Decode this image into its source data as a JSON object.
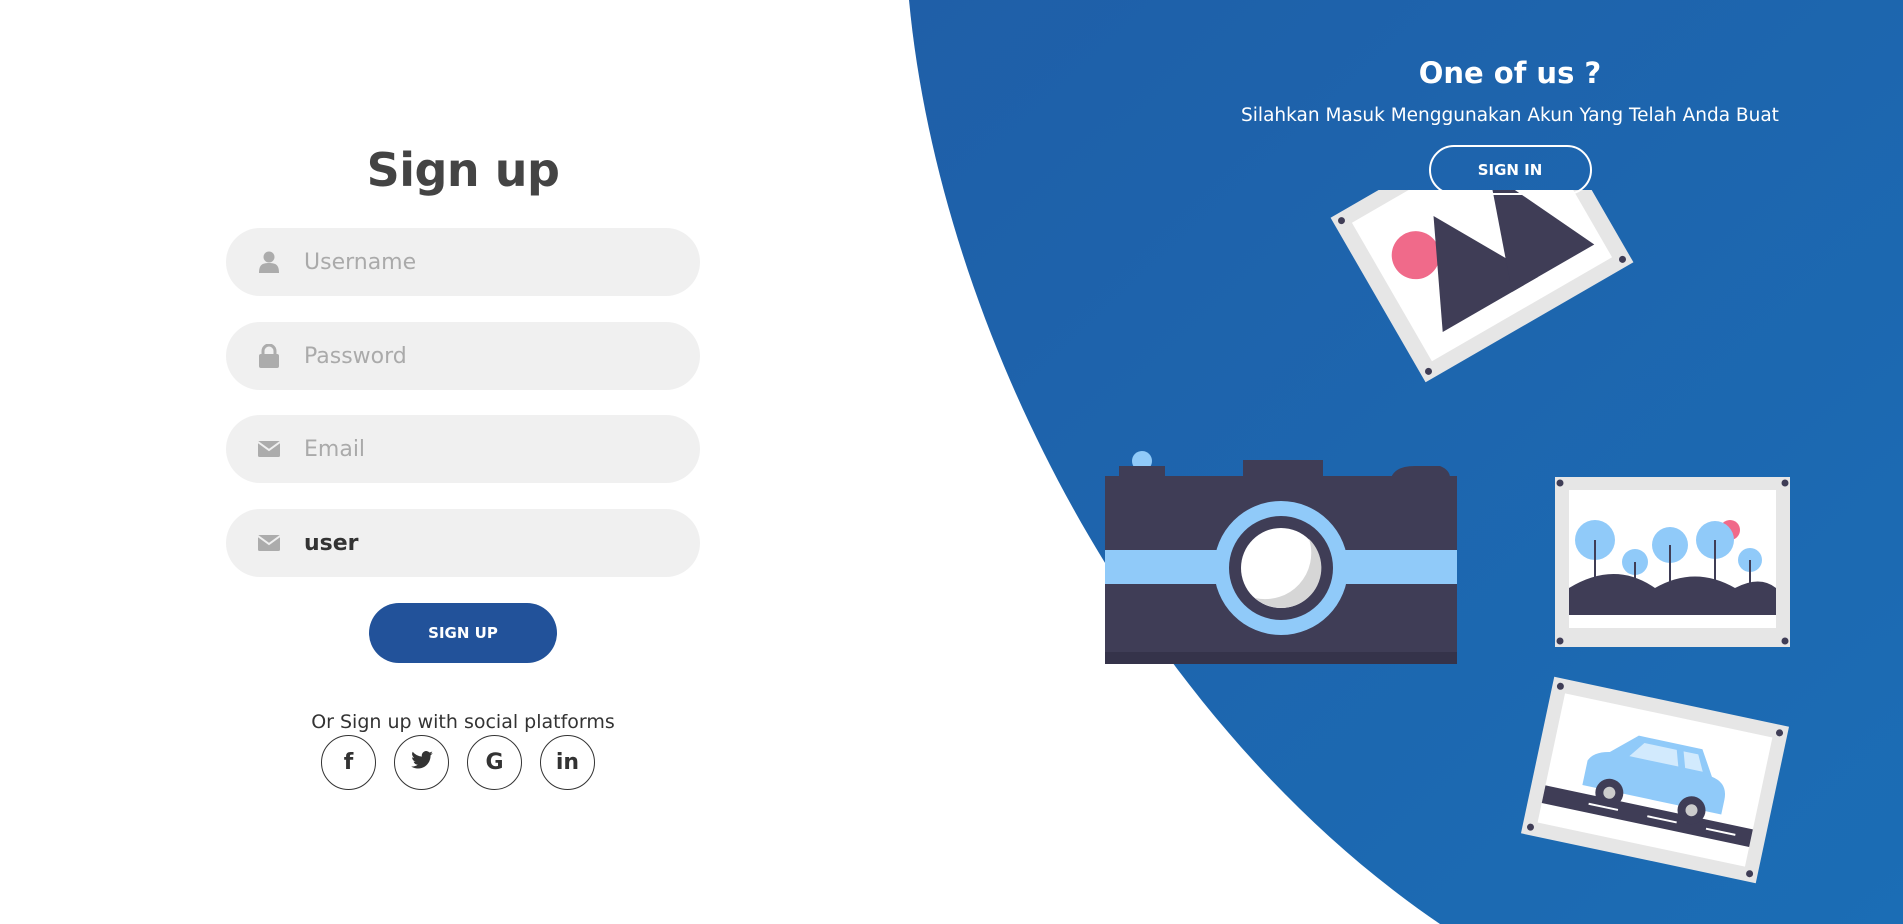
{
  "colors": {
    "panel_blue": "#1e63ae",
    "button_blue": "#22529a",
    "input_bg": "#f0f0f0",
    "placeholder": "#aaaaaa",
    "title_gray": "#444444"
  },
  "signup": {
    "title": "Sign up",
    "fields": [
      {
        "icon": "user-icon",
        "placeholder": "Username",
        "value": ""
      },
      {
        "icon": "lock-icon",
        "placeholder": "Password",
        "value": ""
      },
      {
        "icon": "envelope-icon",
        "placeholder": "Email",
        "value": ""
      },
      {
        "icon": "envelope-icon",
        "placeholder": "",
        "value": "user"
      }
    ],
    "submit_label": "SIGN UP",
    "social_text": "Or Sign up with social platforms",
    "social": [
      {
        "icon": "facebook-icon",
        "glyph": "f"
      },
      {
        "icon": "twitter-icon",
        "glyph": ""
      },
      {
        "icon": "google-icon",
        "glyph": "G"
      },
      {
        "icon": "linkedin-icon",
        "glyph": "in"
      }
    ]
  },
  "panel": {
    "title": "One of us ?",
    "subtitle": "Silahkan Masuk Menggunakan Akun Yang Telah Anda Buat",
    "button_label": "SIGN IN"
  }
}
